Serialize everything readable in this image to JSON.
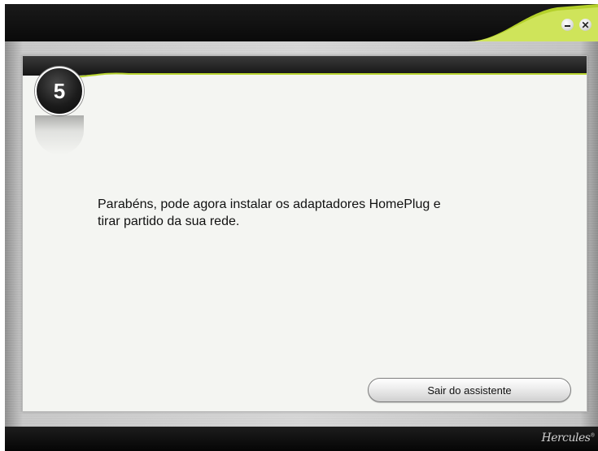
{
  "window": {
    "controls": {
      "minimize_icon": "minimize-icon",
      "close_icon": "close-icon"
    },
    "brand": "Hercules"
  },
  "wizard": {
    "step_number": "5",
    "message_line1": "Parabéns, pode agora instalar os adaptadores HomePlug e",
    "message_line2": "tirar partido da sua rede.",
    "exit_label": "Sair do assistente"
  },
  "colors": {
    "accent": "#b8d430",
    "frame": "#111111"
  }
}
